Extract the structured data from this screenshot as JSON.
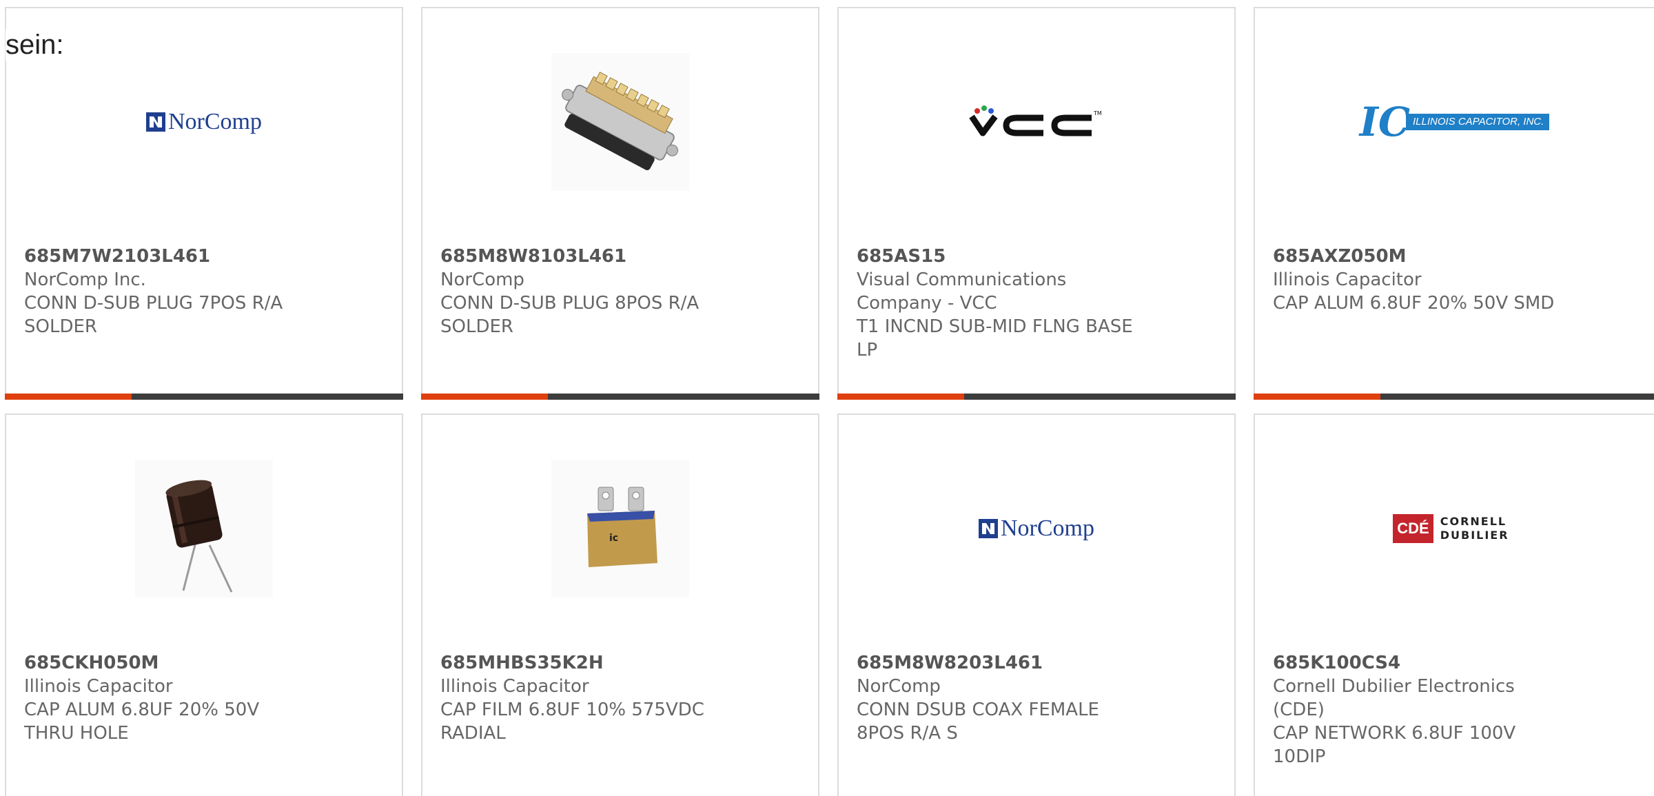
{
  "intro_text": "sein:",
  "colors": {
    "accent": "#e0400f",
    "bar": "#3d3d3d",
    "norcomp_blue": "#1f3f8f",
    "ic_blue": "#1f7fc7",
    "cde_red": "#c4242b"
  },
  "products": [
    {
      "part_number": "685M7W2103L461",
      "manufacturer": "NorComp Inc.",
      "description": "CONN D-SUB PLUG 7POS R/A SOLDER",
      "image": "norcomp-logo",
      "logo_text": "NorComp"
    },
    {
      "part_number": "685M8W8103L461",
      "manufacturer": "NorComp",
      "description": "CONN D-SUB PLUG 8POS R/A SOLDER",
      "image": "dsub-connector-photo"
    },
    {
      "part_number": "685AS15",
      "manufacturer": "Visual Communications Company - VCC",
      "description": "T1 INCND SUB-MID FLNG BASE LP",
      "image": "vcc-logo",
      "logo_text": "VCC"
    },
    {
      "part_number": "685AXZ050M",
      "manufacturer": "Illinois Capacitor",
      "description": "CAP ALUM 6.8UF 20% 50V SMD",
      "image": "illinois-capacitor-logo",
      "logo_text": "ILLINOIS CAPACITOR, INC."
    },
    {
      "part_number": "685CKH050M",
      "manufacturer": "Illinois Capacitor",
      "description": "CAP ALUM 6.8UF 20% 50V THRU HOLE",
      "image": "electrolytic-capacitor-photo"
    },
    {
      "part_number": "685MHBS35K2H",
      "manufacturer": "Illinois Capacitor",
      "description": "CAP FILM 6.8UF 10% 575VDC RADIAL",
      "image": "film-capacitor-photo"
    },
    {
      "part_number": "685M8W8203L461",
      "manufacturer": "NorComp",
      "description": "CONN DSUB COAX FEMALE 8POS R/A S",
      "image": "norcomp-logo",
      "logo_text": "NorComp"
    },
    {
      "part_number": "685K100CS4",
      "manufacturer": "Cornell Dubilier Electronics (CDE)",
      "description": "CAP NETWORK 6.8UF 100V 10DIP",
      "image": "cde-logo",
      "logo_text": "CDÉ",
      "logo_words": "CORNELL DUBILIER"
    }
  ]
}
